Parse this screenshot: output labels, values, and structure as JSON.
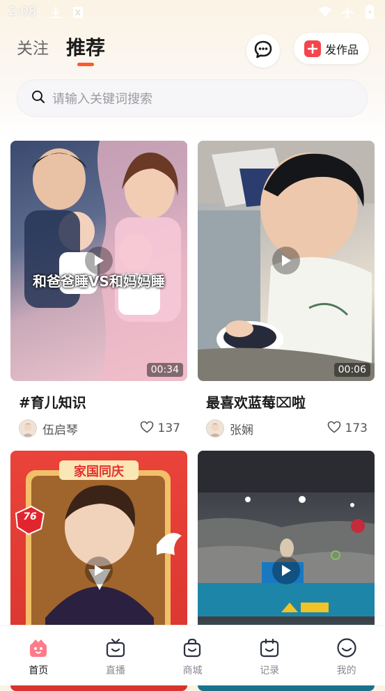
{
  "status_bar": {
    "time": "2:08",
    "left_icons": [
      "download-icon",
      "notification-icon"
    ],
    "right_icons": [
      "wifi-icon",
      "airplane-icon",
      "battery-icon"
    ]
  },
  "header": {
    "tabs": [
      {
        "label": "关注",
        "active": false
      },
      {
        "label": "推荐",
        "active": true
      }
    ],
    "message_icon": "chat-bubble-icon",
    "publish_label": "发作品"
  },
  "search": {
    "placeholder": "请输入关键词搜索"
  },
  "feed": [
    {
      "thumbnail_overlay": "和爸爸睡VS和妈妈睡",
      "duration": "00:34",
      "title": "#育儿知识",
      "author": "伍启琴",
      "likes": "137"
    },
    {
      "duration": "00:06",
      "title": "最喜欢蓝莓⌧啦",
      "author": "张娴",
      "likes": "173"
    },
    {
      "thumbnail_overlay": "家国同庆",
      "badge": "76",
      "duration": "",
      "title": "",
      "author": "",
      "likes": ""
    },
    {
      "duration": "",
      "title": "",
      "author": "",
      "likes": ""
    }
  ],
  "bottom_nav": [
    {
      "label": "首页",
      "icon": "home-icon",
      "active": true
    },
    {
      "label": "直播",
      "icon": "live-tv-icon",
      "active": false
    },
    {
      "label": "商城",
      "icon": "shopping-bag-icon",
      "active": false
    },
    {
      "label": "记录",
      "icon": "calendar-icon",
      "active": false
    },
    {
      "label": "我的",
      "icon": "profile-face-icon",
      "active": false
    }
  ],
  "colors": {
    "accent": "#ff5a2a",
    "publish_plus": "#f5454c",
    "home_active": "#ff6b7a"
  }
}
